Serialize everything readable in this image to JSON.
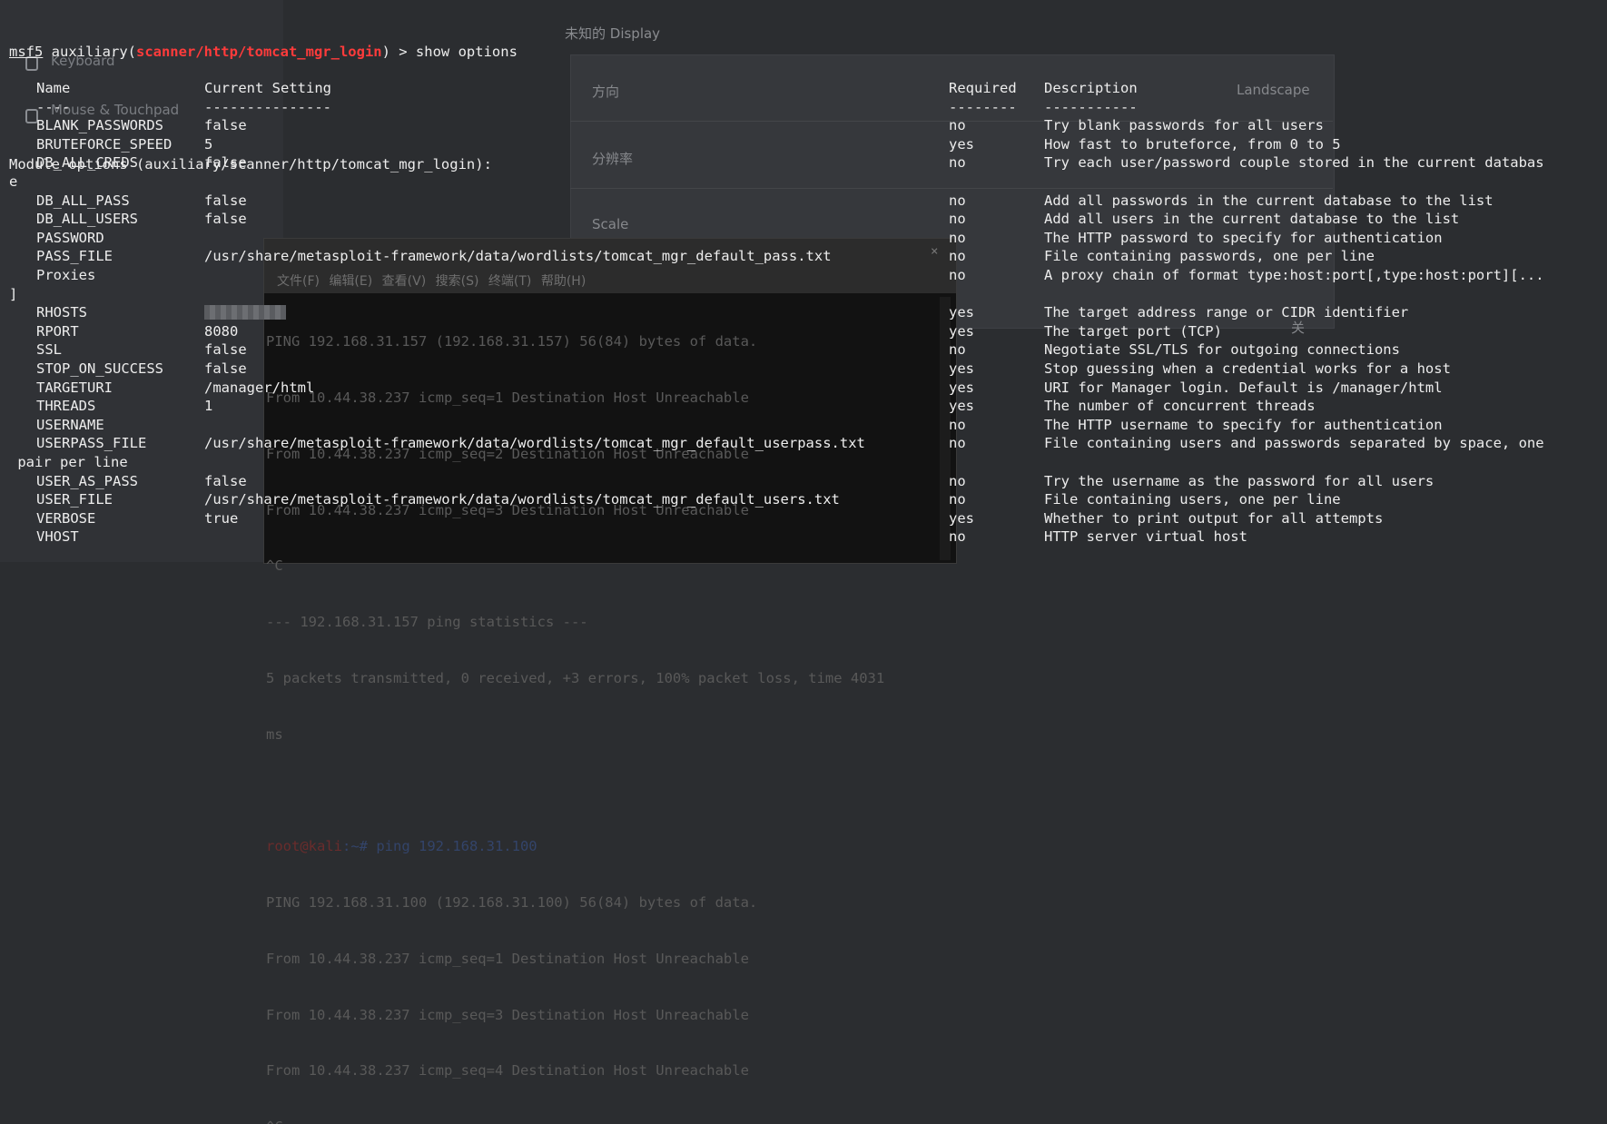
{
  "background_window": {
    "title": "未知的 Display",
    "rows": [
      {
        "label": "方向",
        "value": "Landscape"
      },
      {
        "label": "分辨率",
        "value": ""
      },
      {
        "label": "Scale",
        "value": ""
      }
    ],
    "extra_char": "关",
    "sidebar": [
      "Keyboard",
      "Mouse & Touchpad"
    ]
  },
  "terminal2": {
    "menu": [
      "文件(F)",
      "编辑(E)",
      "查看(V)",
      "搜索(S)",
      "终端(T)",
      "帮助(H)"
    ],
    "close_label": "×",
    "lines": [
      "PING 192.168.31.157 (192.168.31.157) 56(84) bytes of data.",
      "From 10.44.38.237 icmp_seq=1 Destination Host Unreachable",
      "From 10.44.38.237 icmp_seq=2 Destination Host Unreachable",
      "From 10.44.38.237 icmp_seq=3 Destination Host Unreachable",
      "^C",
      "--- 192.168.31.157 ping statistics ---",
      "5 packets transmitted, 0 received, +3 errors, 100% packet loss, time 4031",
      "ms",
      "",
      "",
      "PING 192.168.31.100 (192.168.31.100) 56(84) bytes of data.",
      "From 10.44.38.237 icmp_seq=1 Destination Host Unreachable",
      "From 10.44.38.237 icmp_seq=3 Destination Host Unreachable",
      "From 10.44.38.237 icmp_seq=4 Destination Host Unreachable",
      "^C"
    ],
    "prompt_user": "root@kali",
    "prompt_rest": ":~# ping 192.168.31.100"
  },
  "msf": {
    "prompt_prefix": "msf5",
    "prompt_module_open": " auxiliary(",
    "prompt_module": "scanner/http/tomcat_mgr_login",
    "prompt_command": ") > show options",
    "module_header": "Module options (auxiliary/scanner/http/tomcat_mgr_login):",
    "headers": {
      "name": "Name",
      "setting": "Current Setting",
      "required": "Required",
      "description": "Description"
    },
    "underlines": {
      "name": "----",
      "setting": "---------------",
      "required": "--------",
      "description": "-----------"
    },
    "options": [
      {
        "name": "BLANK_PASSWORDS",
        "setting": "false",
        "required": "no",
        "description": "Try blank passwords for all users"
      },
      {
        "name": "BRUTEFORCE_SPEED",
        "setting": "5",
        "required": "yes",
        "description": "How fast to bruteforce, from 0 to 5"
      },
      {
        "name": "DB_ALL_CREDS",
        "setting": "false",
        "required": "no",
        "description": "Try each user/password couple stored in the current databas",
        "wrap": "e"
      },
      {
        "name": "DB_ALL_PASS",
        "setting": "false",
        "required": "no",
        "description": "Add all passwords in the current database to the list"
      },
      {
        "name": "DB_ALL_USERS",
        "setting": "false",
        "required": "no",
        "description": "Add all users in the current database to the list"
      },
      {
        "name": "PASSWORD",
        "setting": "",
        "required": "no",
        "description": "The HTTP password to specify for authentication"
      },
      {
        "name": "PASS_FILE",
        "setting": "/usr/share/metasploit-framework/data/wordlists/tomcat_mgr_default_pass.txt",
        "required": "no",
        "description": "File containing passwords, one per line"
      },
      {
        "name": "Proxies",
        "setting": "",
        "required": "no",
        "description": "A proxy chain of format type:host:port[,type:host:port][...",
        "wrap": "]"
      },
      {
        "name": "RHOSTS",
        "setting": "",
        "required": "yes",
        "description": "The target address range or CIDR identifier"
      },
      {
        "name": "RPORT",
        "setting": "8080",
        "required": "yes",
        "description": "The target port (TCP)"
      },
      {
        "name": "SSL",
        "setting": "false",
        "required": "no",
        "description": "Negotiate SSL/TLS for outgoing connections"
      },
      {
        "name": "STOP_ON_SUCCESS",
        "setting": "false",
        "required": "yes",
        "description": "Stop guessing when a credential works for a host"
      },
      {
        "name": "TARGETURI",
        "setting": "/manager/html",
        "required": "yes",
        "description": "URI for Manager login. Default is /manager/html"
      },
      {
        "name": "THREADS",
        "setting": "1",
        "required": "yes",
        "description": "The number of concurrent threads"
      },
      {
        "name": "USERNAME",
        "setting": "",
        "required": "no",
        "description": "The HTTP username to specify for authentication"
      },
      {
        "name": "USERPASS_FILE",
        "setting": "/usr/share/metasploit-framework/data/wordlists/tomcat_mgr_default_userpass.txt",
        "required": "no",
        "description": "File containing users and passwords separated by space, one",
        "wrap": " pair per line"
      },
      {
        "name": "USER_AS_PASS",
        "setting": "false",
        "required": "no",
        "description": "Try the username as the password for all users"
      },
      {
        "name": "USER_FILE",
        "setting": "/usr/share/metasploit-framework/data/wordlists/tomcat_mgr_default_users.txt",
        "required": "no",
        "description": "File containing users, one per line"
      },
      {
        "name": "VERBOSE",
        "setting": "true",
        "required": "yes",
        "description": "Whether to print output for all attempts"
      },
      {
        "name": "VHOST",
        "setting": "",
        "required": "no",
        "description": "HTTP server virtual host"
      }
    ]
  }
}
